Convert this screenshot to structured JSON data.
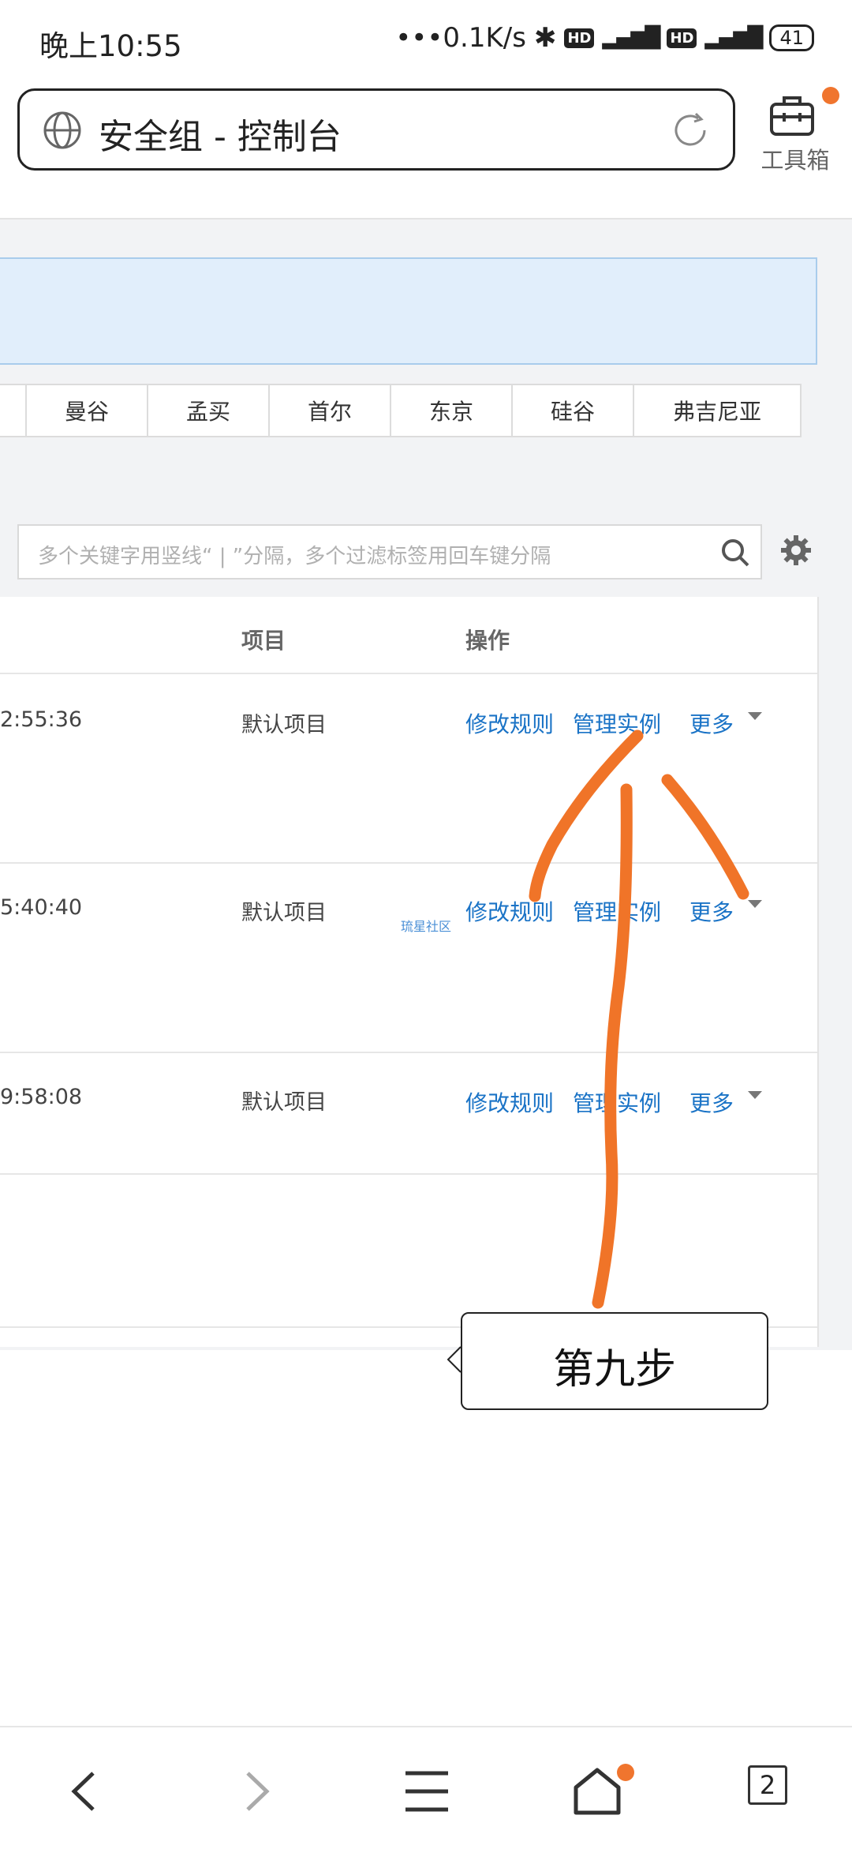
{
  "status_bar": {
    "time": "晚上10:55",
    "network_speed": "•••0.1K/s",
    "hd1": "HD",
    "hd2": "HD",
    "battery": "41"
  },
  "browser": {
    "address_text": "安全组 - 控制台",
    "toolbox_label": "工具箱"
  },
  "regions": [
    "曼谷",
    "孟买",
    "首尔",
    "东京",
    "硅谷",
    "弗吉尼亚"
  ],
  "search": {
    "placeholder": "多个关键字用竖线“ | ”分隔，多个过滤标签用回车键分隔"
  },
  "table": {
    "headers": {
      "project": "项目",
      "actions": "操作"
    },
    "rows": [
      {
        "time": "2:55:36",
        "project": "默认项目",
        "edit": "修改规则",
        "manage": "管理实例",
        "more": "更多"
      },
      {
        "time": "5:40:40",
        "project": "默认项目",
        "edit": "修改规则",
        "manage": "管理实例",
        "more": "更多"
      },
      {
        "time": "9:58:08",
        "project": "默认项目",
        "edit": "修改规则",
        "manage": "管理实例",
        "more": "更多"
      }
    ]
  },
  "watermark": "琉星社区",
  "annotation": {
    "callout": "第九步",
    "stroke_color": "#f07428"
  },
  "bottom_nav": {
    "tabs_count": "2"
  },
  "colors": {
    "link": "#1a73c6",
    "accent_dot": "#f0752e"
  }
}
